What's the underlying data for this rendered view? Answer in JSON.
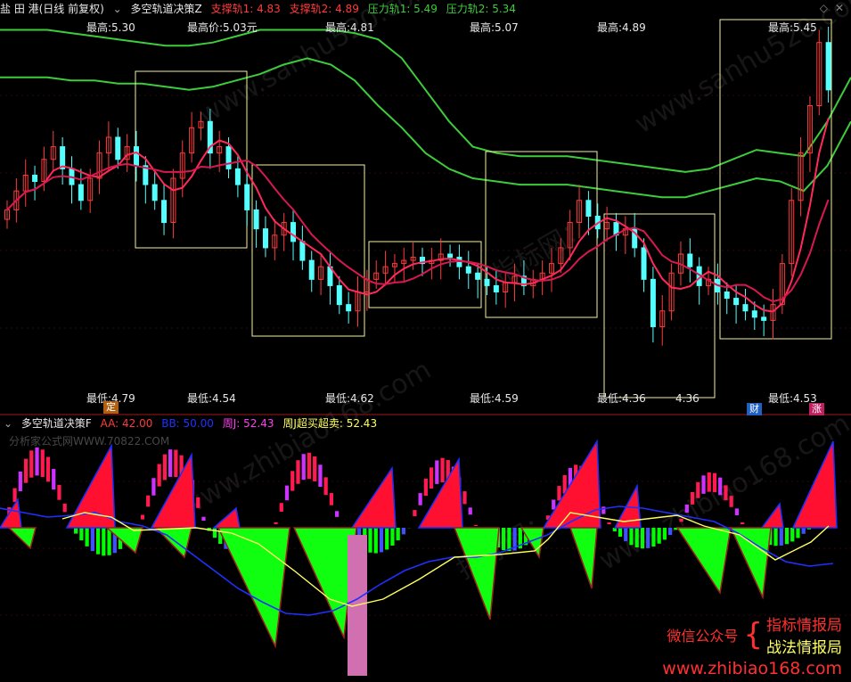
{
  "upper_header": {
    "stock": "盐 田 港(日线 前复权)",
    "indicator": "多空轨道决策Z",
    "support1_label": "支撑轨1: 4.83",
    "support2_label": "支撑轨2: 4.89",
    "press1_label": "压力轨1: 5.49",
    "press2_label": "压力轨2: 5.34"
  },
  "lower_header": {
    "indicator": "多空轨道决策F",
    "aa_label": "AA: 42.00",
    "bb_label": "BB: 50.00",
    "week_label": "周J: 52.43",
    "over_label": "周J超买超卖: 52.43"
  },
  "highs": [
    "最高:5.30",
    "最高价:5.03元",
    "最高:4.81",
    "最高:5.07",
    "最高:4.89",
    "最高:5.45"
  ],
  "lows": [
    "最低:4.79",
    "最低:4.54",
    "最低:4.62",
    "最低:4.59",
    "最低:4.36",
    "4.36",
    "最低:4.53"
  ],
  "badges": {
    "ding": "定",
    "cai": "财",
    "zhang": "涨"
  },
  "watermarks": [
    "www.sanhu520.com",
    "指标网：",
    "www.zhibiao168.com",
    "分析家公式网WWW.70822.COM"
  ],
  "promo": {
    "wechat": "微信公众号",
    "line1": "指标情报局",
    "line2": "战法情报局",
    "url": "www.zhibiao168.com"
  },
  "colors": {
    "up": "#ff3b3b",
    "down": "#54ffff",
    "green_band": "#3ccc3c",
    "red_band": "#ff2a5a",
    "box": "#f5f0a0",
    "hist_pos": "#ff1a50",
    "hist_neg": "#00ff00",
    "blue_line": "#2030ff",
    "yellow_line": "#ffff60"
  },
  "chart_data": [
    {
      "type": "line",
      "subtype": "candlestick",
      "title": "多空轨道决策Z",
      "xlabel": "",
      "ylabel": "",
      "ylim": [
        4.3,
        5.5
      ],
      "close": [
        4.92,
        4.98,
        5.03,
        5.01,
        5.08,
        5.12,
        5.05,
        5.0,
        4.95,
        5.02,
        5.1,
        5.15,
        5.08,
        5.12,
        5.06,
        5.0,
        4.95,
        4.88,
        5.02,
        5.1,
        5.18,
        5.2,
        5.1,
        5.12,
        5.05,
        5.0,
        4.92,
        4.86,
        4.8,
        4.84,
        4.88,
        4.82,
        4.76,
        4.7,
        4.74,
        4.68,
        4.62,
        4.6,
        4.66,
        4.7,
        4.72,
        4.74,
        4.75,
        4.76,
        4.77,
        4.75,
        4.76,
        4.78,
        4.77,
        4.74,
        4.72,
        4.7,
        4.68,
        4.66,
        4.69,
        4.71,
        4.68,
        4.7,
        4.72,
        4.75,
        4.8,
        4.88,
        4.95,
        4.9,
        4.86,
        4.88,
        4.84,
        4.86,
        4.8,
        4.7,
        4.55,
        4.6,
        4.72,
        4.78,
        4.74,
        4.68,
        4.7,
        4.66,
        4.64,
        4.62,
        4.6,
        4.58,
        4.57,
        4.62,
        4.75,
        4.95,
        5.1,
        5.25,
        5.45,
        5.3
      ],
      "band_upper": [
        5.49,
        5.49,
        5.49,
        5.48,
        5.47,
        5.46,
        5.45,
        5.44,
        5.44,
        5.45,
        5.47,
        5.49,
        5.49,
        5.49,
        5.49,
        5.48,
        5.46,
        5.4,
        5.3,
        5.2,
        5.12,
        5.1,
        5.09,
        5.09,
        5.09,
        5.08,
        5.07,
        5.06,
        5.05,
        5.04,
        5.05,
        5.08,
        5.11,
        5.1,
        5.09,
        5.2,
        5.34
      ],
      "band_lower": [
        5.34,
        5.34,
        5.34,
        5.33,
        5.33,
        5.32,
        5.32,
        5.31,
        5.3,
        5.31,
        5.33,
        5.35,
        5.38,
        5.4,
        5.38,
        5.33,
        5.25,
        5.18,
        5.1,
        5.05,
        5.02,
        5.01,
        5.0,
        5.0,
        5.0,
        4.99,
        4.98,
        4.97,
        4.96,
        4.96,
        4.98,
        5.0,
        5.02,
        5.01,
        4.98,
        5.06,
        5.2
      ]
    },
    {
      "type": "bar",
      "title": "多空轨道决策F",
      "xlabel": "",
      "ylabel": "",
      "ylim": [
        -100,
        100
      ],
      "series": [
        {
          "name": "AA",
          "values": [
            42.0
          ]
        },
        {
          "name": "BB",
          "values": [
            50.0
          ]
        },
        {
          "name": "周J",
          "values": [
            52.43
          ]
        }
      ]
    }
  ]
}
